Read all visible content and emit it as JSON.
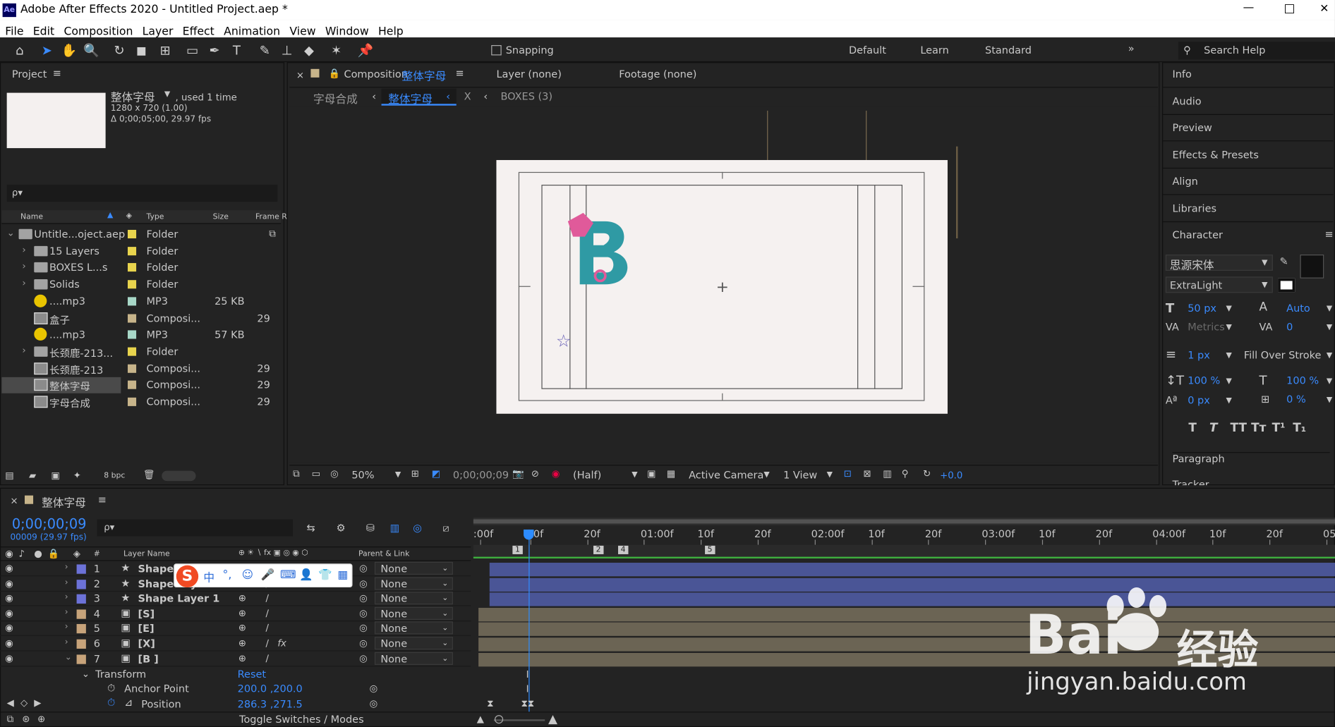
{
  "app": {
    "title": "Adobe After Effects 2020 - Untitled Project.aep *",
    "logo": "Ae"
  },
  "window_controls": {
    "minimize": "—",
    "maximize": "□",
    "close": "✕"
  },
  "menu": [
    "File",
    "Edit",
    "Composition",
    "Layer",
    "Effect",
    "Animation",
    "View",
    "Window",
    "Help"
  ],
  "toolbar": {
    "snapping": "Snapping",
    "workspaces": [
      "Default",
      "Learn",
      "Standard"
    ],
    "search": "Search Help"
  },
  "project": {
    "tab": "Project",
    "selected_name": "整体字母",
    "used": ", used 1 time",
    "dims": "1280 x 720 (1.00)",
    "duration": "Δ 0;00;05;00, 29.97 fps",
    "search_placeholder": "ρ▾",
    "headers": {
      "name": "Name",
      "type": "Type",
      "size": "Size",
      "frame": "Frame R"
    },
    "items": [
      {
        "name": "Untitle...oject.aep",
        "type": "Folder",
        "size": "",
        "frame": "",
        "icon": "folder",
        "indent": 0,
        "color": "#e8d44d"
      },
      {
        "name": "15 Layers",
        "type": "Folder",
        "size": "",
        "frame": "",
        "icon": "folder",
        "indent": 1,
        "color": "#e8d44d"
      },
      {
        "name": "BOXES L...s",
        "type": "Folder",
        "size": "",
        "frame": "",
        "icon": "folder",
        "indent": 1,
        "color": "#e8d44d"
      },
      {
        "name": "Solids",
        "type": "Folder",
        "size": "",
        "frame": "",
        "icon": "folder",
        "indent": 1,
        "color": "#e8d44d"
      },
      {
        "name": "....mp3",
        "type": "MP3",
        "size": "25 KB",
        "frame": "",
        "icon": "audio",
        "indent": 1,
        "color": "#a8d8c8"
      },
      {
        "name": "盒子",
        "type": "Composi...",
        "size": "",
        "frame": "29",
        "icon": "comp",
        "indent": 1,
        "color": "#c7b48a"
      },
      {
        "name": "....mp3",
        "type": "MP3",
        "size": "57 KB",
        "frame": "",
        "icon": "audio",
        "indent": 1,
        "color": "#a8d8c8"
      },
      {
        "name": "长颈鹿-213...",
        "type": "Folder",
        "size": "",
        "frame": "",
        "icon": "folder",
        "indent": 1,
        "color": "#e8d44d"
      },
      {
        "name": "长颈鹿-213",
        "type": "Composi...",
        "size": "",
        "frame": "29",
        "icon": "comp",
        "indent": 1,
        "color": "#c7b48a"
      },
      {
        "name": "整体字母",
        "type": "Composi...",
        "size": "",
        "frame": "29",
        "icon": "comp",
        "indent": 1,
        "color": "#c7b48a",
        "selected": true
      },
      {
        "name": "字母合成",
        "type": "Composi...",
        "size": "",
        "frame": "29",
        "icon": "comp",
        "indent": 1,
        "color": "#c7b48a"
      }
    ],
    "bpc": "8 bpc"
  },
  "viewer": {
    "tab": "Composition",
    "comp_name": "整体字母",
    "layer_tab": "Layer  (none)",
    "footage_tab": "Footage  (none)",
    "breadcrumbs": [
      "字母合成",
      "整体字母",
      "X",
      "BOXES (3)"
    ],
    "zoom": "50%",
    "timecode": "0;00;00;09",
    "resolution": "(Half)",
    "camera": "Active Camera",
    "views": "1 View",
    "exposure": "+0.0"
  },
  "right_panel": {
    "items": [
      "Info",
      "Audio",
      "Preview",
      "Effects & Presets",
      "Align",
      "Libraries"
    ],
    "character": {
      "title": "Character",
      "font": "思源宋体",
      "style": "ExtraLight",
      "size": "50 px",
      "leading": "Auto",
      "kerning": "Metrics",
      "tracking": "0",
      "stroke_width": "1 px",
      "stroke_mode": "Fill Over Stroke",
      "vscale": "100 %",
      "hscale": "100 %",
      "baseline": "0 px",
      "tsume": "0 %",
      "styles": [
        "T",
        "T",
        "TT",
        "Tт",
        "T¹",
        "T₁"
      ]
    },
    "paragraph": "Paragraph",
    "tracker": "Tracker"
  },
  "timeline": {
    "comp_name": "整体字母",
    "timecode": "0;00;00;09",
    "frame_info": "00009 (29.97 fps)",
    "headers": {
      "layer_name": "Layer Name",
      "parent": "Parent & Link"
    },
    "ruler": [
      ":00f",
      "10f",
      "20f",
      "01:00f",
      "10f",
      "20f",
      "02:00f",
      "10f",
      "20f",
      "03:00f",
      "10f",
      "20f",
      "04:00f",
      "10f",
      "20f",
      "05:0"
    ],
    "markers": [
      "1",
      "2",
      "4",
      "5"
    ],
    "layers": [
      {
        "num": "1",
        "name": "Shape",
        "parent": "None",
        "color": "#6c72d8",
        "type": "shape"
      },
      {
        "num": "2",
        "name": "Shape Layer 2",
        "parent": "None",
        "color": "#6c72d8",
        "type": "shape"
      },
      {
        "num": "3",
        "name": "Shape Layer 1",
        "parent": "None",
        "color": "#6c72d8",
        "type": "shape"
      },
      {
        "num": "4",
        "name": "[S]",
        "parent": "None",
        "color": "#c7a37a",
        "type": "comp"
      },
      {
        "num": "5",
        "name": "[E]",
        "parent": "None",
        "color": "#c7a37a",
        "type": "comp"
      },
      {
        "num": "6",
        "name": "[X]",
        "parent": "None",
        "color": "#c7a37a",
        "type": "comp",
        "fx": "fx"
      },
      {
        "num": "7",
        "name": "[B ]",
        "parent": "None",
        "color": "#c7a37a",
        "type": "comp"
      }
    ],
    "transform": "Transform",
    "reset": "Reset",
    "anchor_label": "Anchor Point",
    "anchor_value": "200.0 ,200.0",
    "position_label": "Position",
    "position_value": "286.3 ,271.5",
    "toggle": "Toggle Switches / Modes"
  },
  "ime": {
    "logo": "S",
    "items": [
      "中",
      "°,",
      "☺",
      "🎤",
      "⌨",
      "👤",
      "👕",
      "▦"
    ]
  },
  "watermark": {
    "main": "Bai",
    "cn": "经验",
    "url": "jingyan.baidu.com"
  },
  "colors": {
    "accent": "#3a8bff",
    "shape_bar": "#4a5596",
    "comp_bar": "#6b6454",
    "playhead": "#2d8cff"
  }
}
